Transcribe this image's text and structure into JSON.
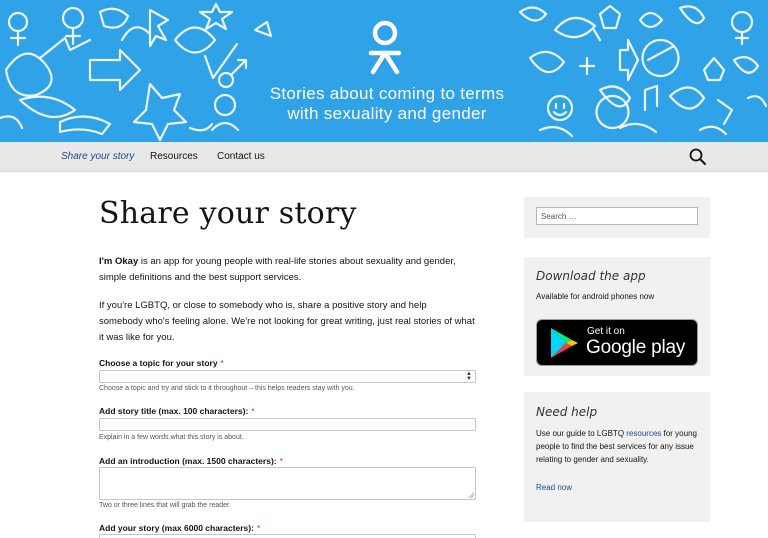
{
  "header": {
    "tagline_line1": "Stories about coming to terms",
    "tagline_line2": "with sexuality and gender",
    "bg_color": "#2fa2e8"
  },
  "nav": {
    "items": [
      {
        "label": "Share your story",
        "active": true
      },
      {
        "label": "Resources",
        "active": false
      },
      {
        "label": "Contact us",
        "active": false
      }
    ],
    "search_icon": "search-icon"
  },
  "main": {
    "title": "Share your story",
    "intro_brand": "I'm Okay",
    "intro_line1_rest": " is an app for young people with real-life stories about sexuality and gender,",
    "intro_line2": "simple definitions and the best support services.",
    "para2_line1": "If you're LGBTQ, or close to somebody who is, share a positive story and help",
    "para2_line2": "somebody who's feeling alone. We're not looking for great writing, just real stories of what",
    "para2_line3": "it was like for you.",
    "form": {
      "topic_label": "Choose a topic for your story",
      "topic_hint": "Choose a topic and try and stick to it throughout – this helps readers stay with you.",
      "title_label": "Add story title (max. 100 characters):",
      "title_hint": "Explain in a few words what this story is about.",
      "intro_label": "Add an introduction (max. 1500 characters):",
      "intro_hint": "Two or three lines that will grab the reader.",
      "story_label": "Add your story (max 6000 characters):",
      "required_mark": "*"
    }
  },
  "sidebar": {
    "search_placeholder": "Search …",
    "download": {
      "title": "Download the app",
      "text": "Available for android phones now",
      "badge_line1": "Get it on",
      "badge_line2": "Google play"
    },
    "help": {
      "title": "Need help",
      "text_before": "Use our guide to LGBTQ ",
      "text_link": "resources",
      "text_after": " for young",
      "line2": "people to find the best services for any issue",
      "line3": "relating to gender and sexuality.",
      "read_more": "Read now"
    }
  }
}
